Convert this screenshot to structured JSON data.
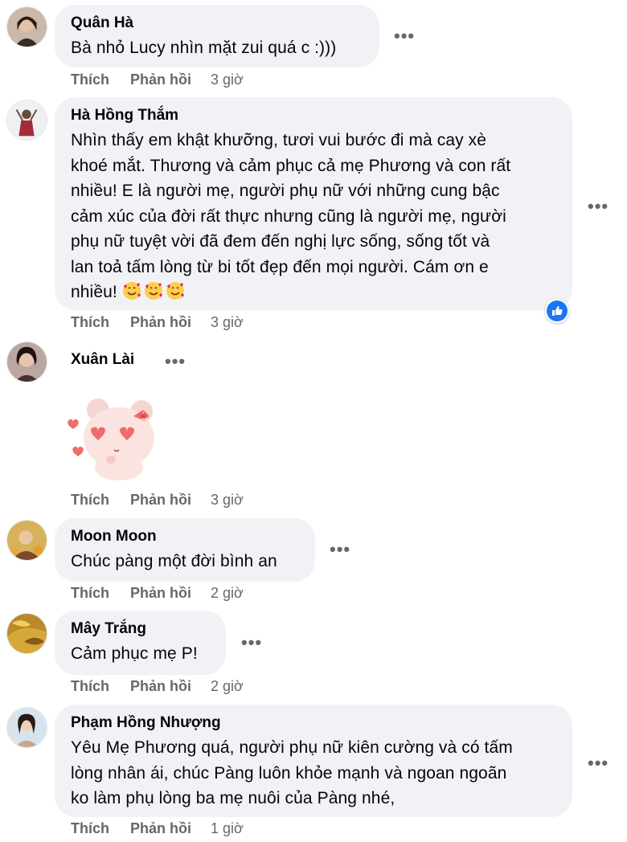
{
  "actions": {
    "like": "Thích",
    "reply": "Phản hồi"
  },
  "comments": [
    {
      "name": "Quân Hà",
      "text": "Bà nhỏ Lucy nhìn mặt zui quá c :)))",
      "time": "3 giờ"
    },
    {
      "name": "Hà Hồng Thắm",
      "lines": [
        "Nhìn thấy em khật khưỡng, tươi vui bước đi mà cay xè",
        "khoé mắt. Thương và cảm phục cả mẹ Phương và con rất",
        "nhiều! E là người mẹ, người phụ nữ với những cung bậc",
        "cảm xúc của đời rất thực nhưng cũng là người mẹ, người",
        "phụ nữ tuyệt vời đã đem đến nghị lực sống, sống tốt và",
        "lan toả tấm lòng từ bi tốt đẹp đến mọi người. Cám ơn e",
        "nhiều!"
      ],
      "time": "3 giờ",
      "reaction": "like-icon"
    },
    {
      "name": "Xuân Lài",
      "sticker": "pink-bear-love-sticker",
      "time": "3 giờ"
    },
    {
      "name": "Moon Moon",
      "text": "Chúc pàng một đời bình an",
      "time": "2 giờ"
    },
    {
      "name": "Mây Trắng",
      "text": "Cảm phục mẹ P!",
      "time": "2 giờ"
    },
    {
      "name": "Phạm Hồng Nhượng",
      "lines": [
        "Yêu Mẹ Phương quá, người phụ nữ kiên cường và có tấm",
        "lòng nhân ái, chúc Pàng luôn khỏe mạnh và ngoan ngoãn",
        "ko làm phụ lòng ba mẹ nuôi của Pàng nhé,"
      ],
      "time": "1 giờ"
    }
  ],
  "more_label": "•••",
  "colors": {
    "bubble": "#f0f2f5",
    "meta": "#65676b",
    "like_blue": "#1877f2"
  }
}
